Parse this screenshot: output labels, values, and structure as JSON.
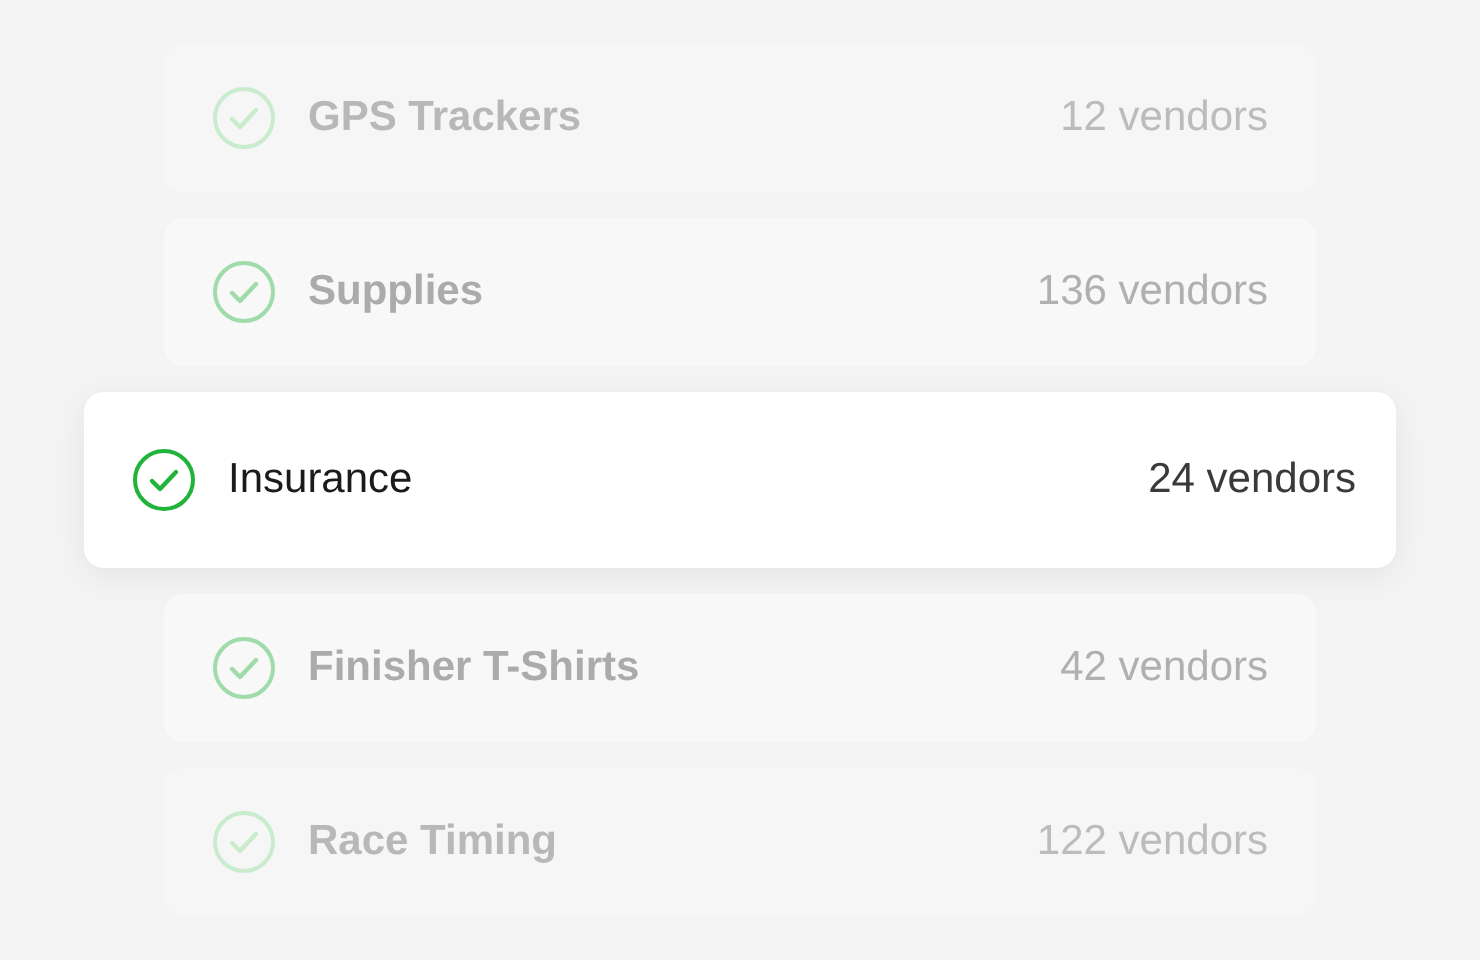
{
  "categories": [
    {
      "name": "GPS Trackers",
      "count": "12 vendors",
      "selected": false
    },
    {
      "name": "Supplies",
      "count": "136 vendors",
      "selected": false
    },
    {
      "name": "Insurance",
      "count": "24 vendors",
      "selected": true
    },
    {
      "name": "Finisher T-Shirts",
      "count": "42 vendors",
      "selected": false
    },
    {
      "name": "Race Timing",
      "count": "122 vendors",
      "selected": false
    }
  ]
}
